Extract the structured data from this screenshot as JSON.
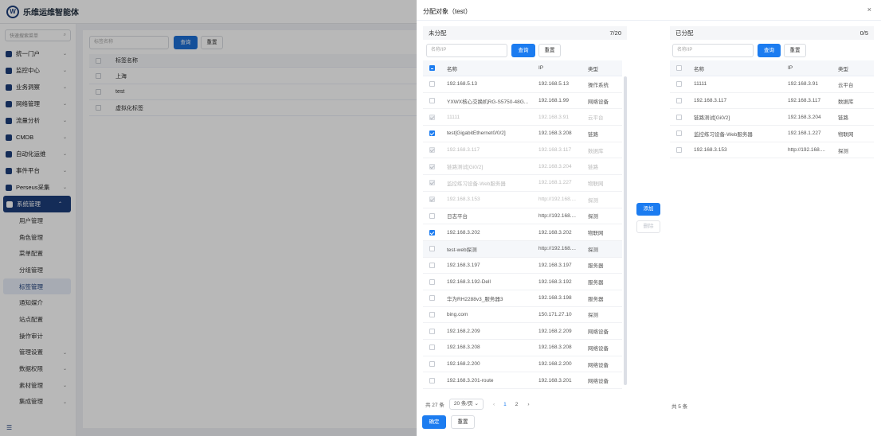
{
  "app": {
    "title": "乐维运维智能体",
    "menu_search_placeholder": "快速搜索菜单",
    "menu": [
      {
        "label": "统一门户"
      },
      {
        "label": "监控中心"
      },
      {
        "label": "业务洞察"
      },
      {
        "label": "网络管理"
      },
      {
        "label": "流量分析"
      },
      {
        "label": "CMDB"
      },
      {
        "label": "自动化运维"
      },
      {
        "label": "事件平台"
      },
      {
        "label": "Perseus采集"
      },
      {
        "label": "系统管理"
      }
    ],
    "submenu": [
      {
        "label": "用户管理"
      },
      {
        "label": "角色管理"
      },
      {
        "label": "菜单配置"
      },
      {
        "label": "分组管理"
      },
      {
        "label": "标签管理"
      },
      {
        "label": "通知媒介"
      },
      {
        "label": "站点配置"
      },
      {
        "label": "操作审计"
      },
      {
        "label": "管理设置"
      },
      {
        "label": "数据权限"
      },
      {
        "label": "素材管理"
      },
      {
        "label": "集成管理"
      }
    ]
  },
  "background_page": {
    "search_placeholder": "标签名称",
    "query_label": "查询",
    "reset_label": "重置",
    "column_name": "标签名称",
    "rows": [
      "上海",
      "test",
      "虚拟化标签"
    ]
  },
  "drawer": {
    "title": "分配对象（test）",
    "close": "×",
    "add_label": "添加",
    "remove_label": "删除",
    "confirm_label": "确定",
    "reset_label": "重置",
    "left": {
      "title": "未分配",
      "count": "7/20",
      "search_placeholder": "名称/IP",
      "query_label": "查询",
      "reset_label": "重置",
      "columns": {
        "name": "名称",
        "ip": "IP",
        "type": "类型"
      },
      "rows": [
        {
          "name": "192.168.5.13",
          "ip": "192.168.5.13",
          "type": "操作系统"
        },
        {
          "name": "YXWX核心交换机RG-S5750-48G...",
          "ip": "192.168.1.99",
          "type": "网络设备"
        },
        {
          "name": "11111",
          "ip": "192.168.3.91",
          "type": "云平台"
        },
        {
          "name": "test[GigabitEthernet0/0/2]",
          "ip": "192.168.3.208",
          "type": "链路"
        },
        {
          "name": "192.168.3.117",
          "ip": "192.168.3.117",
          "type": "数据库"
        },
        {
          "name": "链路测试[Gi0/2]",
          "ip": "192.168.3.204",
          "type": "链路"
        },
        {
          "name": "监控练习设备-Web服务器",
          "ip": "192.168.1.227",
          "type": "物联网"
        },
        {
          "name": "192.168.3.153",
          "ip": "http://192.168....",
          "type": "探测"
        },
        {
          "name": "日志平台",
          "ip": "http://192.168....",
          "type": "探测"
        },
        {
          "name": "192.168.3.202",
          "ip": "192.168.3.202",
          "type": "物联网"
        },
        {
          "name": "test-web探测",
          "ip": "http://192.168....",
          "type": "探测"
        },
        {
          "name": "192.168.3.197",
          "ip": "192.168.3.197",
          "type": "服务器"
        },
        {
          "name": "192.168.3.192-Dell",
          "ip": "192.168.3.192",
          "type": "服务器"
        },
        {
          "name": "华为RH2288v3_服务器3",
          "ip": "192.168.3.198",
          "type": "服务器"
        },
        {
          "name": "bing.com",
          "ip": "150.171.27.10",
          "type": "探测"
        },
        {
          "name": "192.168.2.209",
          "ip": "192.168.2.209",
          "type": "网络设备"
        },
        {
          "name": "192.168.3.208",
          "ip": "192.168.3.208",
          "type": "网络设备"
        },
        {
          "name": "192.168.2.200",
          "ip": "192.168.2.200",
          "type": "网络设备"
        },
        {
          "name": "192.168.3.201-route",
          "ip": "192.168.3.201",
          "type": "网络设备"
        }
      ],
      "pager": {
        "total": "共 27 条",
        "page_size": "20 条/页",
        "prev": "‹",
        "pages": [
          "1",
          "2"
        ],
        "next": "›"
      }
    },
    "right": {
      "title": "已分配",
      "count": "0/5",
      "search_placeholder": "名称/IP",
      "query_label": "查询",
      "reset_label": "重置",
      "columns": {
        "name": "名称",
        "ip": "IP",
        "type": "类型"
      },
      "rows": [
        {
          "name": "11111",
          "ip": "192.168.3.91",
          "type": "云平台"
        },
        {
          "name": "192.168.3.117",
          "ip": "192.168.3.117",
          "type": "数据库"
        },
        {
          "name": "链路测试[Gi0/2]",
          "ip": "192.168.3.204",
          "type": "链路"
        },
        {
          "name": "监控练习设备-Web服务器",
          "ip": "192.168.1.227",
          "type": "物联网"
        },
        {
          "name": "192.168.3.153",
          "ip": "http://192.168....",
          "type": "探测"
        }
      ],
      "total": "共 5 条"
    }
  }
}
